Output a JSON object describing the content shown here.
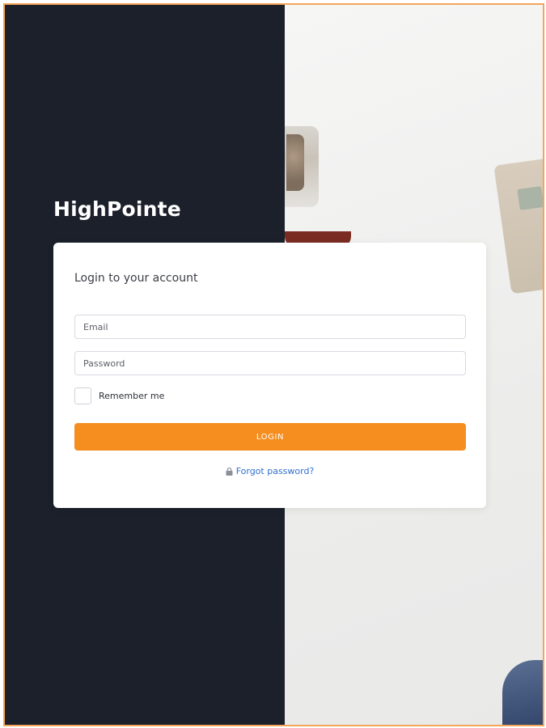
{
  "brand": {
    "name": "HighPointe"
  },
  "login": {
    "title": "Login to your account",
    "email_placeholder": "Email",
    "password_placeholder": "Password",
    "remember_label": "Remember me",
    "submit_label": "LOGIN",
    "forgot_label": "Forgot password?",
    "forgot_icon": "lock-icon"
  },
  "colors": {
    "dark_panel": "#1b202b",
    "accent": "#f58e1f",
    "link": "#2f6fd1",
    "frame_border": "#f4a55a"
  }
}
